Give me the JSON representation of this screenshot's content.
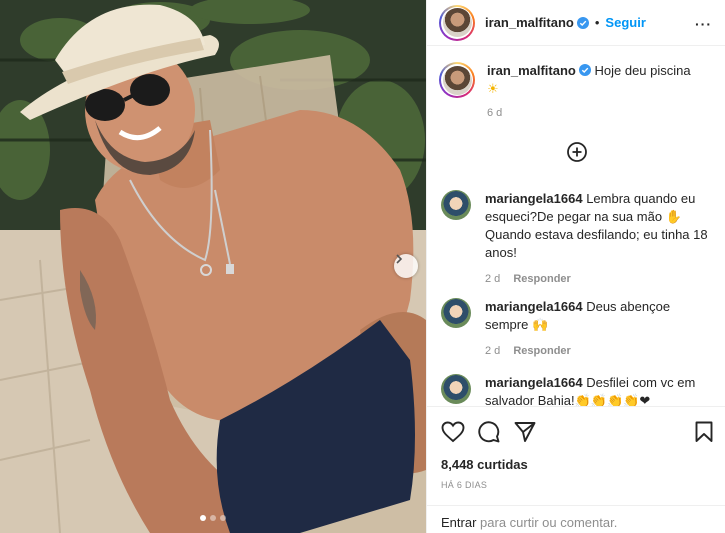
{
  "post": {
    "username": "iran_malfitano",
    "separator": "•",
    "follow_label": "Seguir",
    "more_label": "···",
    "caption": "Hoje deu piscina",
    "caption_emoji": "☀",
    "caption_age": "6 d",
    "image_alt": "Homem sorridente de chapéu e óculos escuros tomando sol",
    "carousel_dots": 3,
    "carousel_active": 1
  },
  "comments": [
    {
      "username": "mariangela1664",
      "text": "Lembra quando eu esqueci?De pegar na sua mão ✋ Quando estava desfilando; eu tinha 18 anos!",
      "age": "2 d",
      "reply_label": "Responder"
    },
    {
      "username": "mariangela1664",
      "text": "Deus abençoe sempre 🙌",
      "age": "2 d",
      "reply_label": "Responder"
    },
    {
      "username": "mariangela1664",
      "text": "Desfilei com vc em salvador Bahia!👏👏👏👏❤",
      "age": "",
      "reply_label": ""
    }
  ],
  "stats": {
    "likes": "8,448 curtidas",
    "date": "HÁ 6 DIAS"
  },
  "footer": {
    "login_label": "Entrar",
    "suffix": "para curtir ou comentar."
  },
  "icons": {
    "verified": "verified-badge-icon",
    "like": "heart-icon",
    "comment": "comment-icon",
    "share": "paper-plane-icon",
    "save": "bookmark-icon",
    "load_more": "plus-circle-icon",
    "next": "chevron-right-icon"
  },
  "colors": {
    "accent": "#0095f6",
    "verified": "#3897f0",
    "muted": "#8e8e8e",
    "text": "#262626"
  }
}
